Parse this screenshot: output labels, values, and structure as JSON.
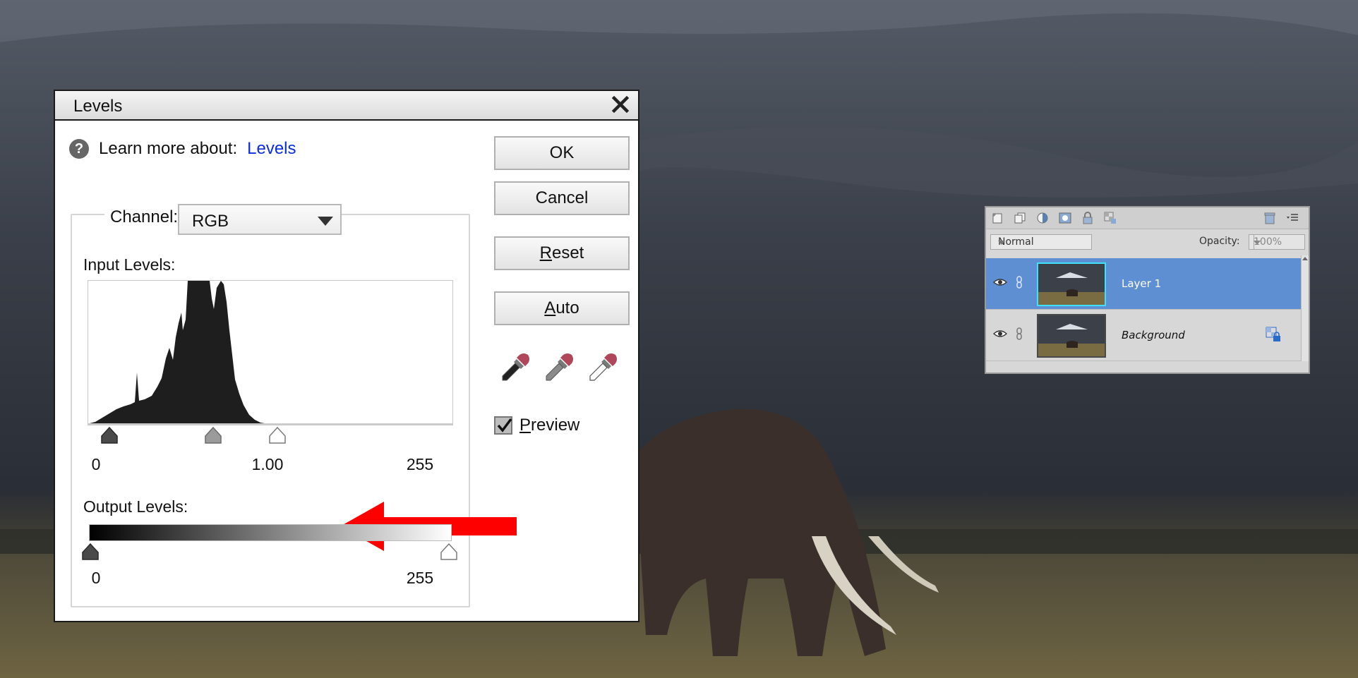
{
  "dialog": {
    "title": "Levels",
    "help_prefix": "Learn more about:",
    "help_link": "Levels",
    "channel_label": "Channel:",
    "channel_value": "RGB",
    "input_label": "Input Levels:",
    "input_black": "0",
    "input_gamma": "1.00",
    "input_white": "255",
    "output_label": "Output Levels:",
    "output_black": "0",
    "output_white": "255",
    "buttons": {
      "ok": "OK",
      "cancel": "Cancel",
      "reset_rest": "eset",
      "reset_mnemonic": "R",
      "auto_rest": "uto",
      "auto_mnemonic": "A"
    },
    "preview_mnemonic": "P",
    "preview_rest": "review",
    "preview_checked": true,
    "icons": [
      "question-icon",
      "close-icon",
      "black-eyedropper-icon",
      "gray-eyedropper-icon",
      "white-eyedropper-icon"
    ]
  },
  "layers_panel": {
    "blend_mode": "Normal",
    "opacity_label": "Opacity:",
    "opacity_value": "100%",
    "layers": [
      {
        "name": "Layer 1",
        "selected": true,
        "italic": false
      },
      {
        "name": "Background",
        "selected": false,
        "italic": true
      }
    ],
    "toolbar_icons": [
      "new-layer-icon",
      "duplicate-icon",
      "adjustment-layer-icon",
      "mask-icon",
      "lock-icon",
      "lock-transparency-icon",
      "trash-icon",
      "panel-menu-icon"
    ]
  },
  "colors": {
    "link": "#0a2de0",
    "selected_layer": "#5f8fd3",
    "annotation_arrow": "#ff0000"
  }
}
